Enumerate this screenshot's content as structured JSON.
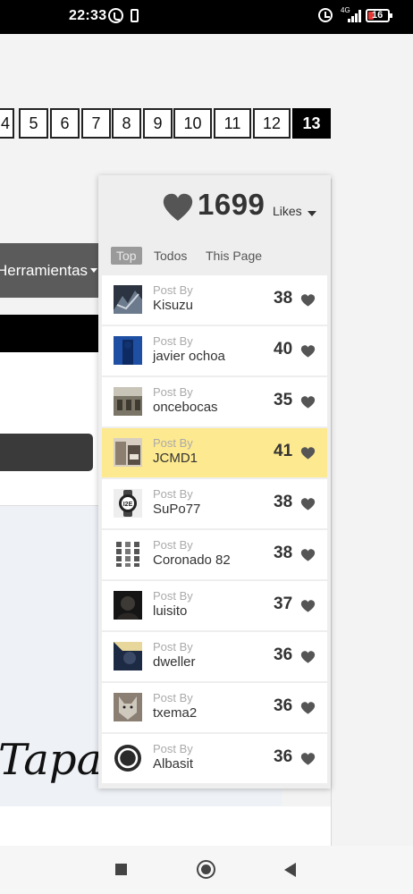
{
  "status_bar": {
    "time": "22:33",
    "network": "4G",
    "battery": "16",
    "icons": [
      "whatsapp-icon",
      "phone-icon",
      "alarm-icon",
      "signal-icon",
      "battery-icon"
    ]
  },
  "pagination": {
    "pages": [
      "4",
      "5",
      "6",
      "7",
      "8",
      "9",
      "10",
      "11",
      "12",
      "13"
    ],
    "current": "13"
  },
  "left_menu": {
    "herramientas_label": "Herramientas"
  },
  "background_text": "Tapat",
  "likes_widget": {
    "count": "1699",
    "label": "Likes",
    "heart_color": "#555555",
    "filters": [
      "Top",
      "Todos",
      "This Page"
    ],
    "active_filter": "Top",
    "post_by_label": "Post By",
    "highlight_color": "#fde98f",
    "entries": [
      {
        "user": "Kisuzu",
        "score": "38"
      },
      {
        "user": "javier ochoa",
        "score": "40"
      },
      {
        "user": "oncebocas",
        "score": "35"
      },
      {
        "user": "JCMD1",
        "score": "41",
        "highlight": true
      },
      {
        "user": "SuPo77",
        "score": "38"
      },
      {
        "user": "Coronado 82",
        "score": "38"
      },
      {
        "user": "luisito",
        "score": "37"
      },
      {
        "user": "dweller",
        "score": "36"
      },
      {
        "user": "txema2",
        "score": "36"
      },
      {
        "user": "Albasit",
        "score": "36"
      }
    ]
  },
  "nav_bar": {
    "icons": [
      "recent-apps-icon",
      "home-icon",
      "back-icon"
    ]
  }
}
